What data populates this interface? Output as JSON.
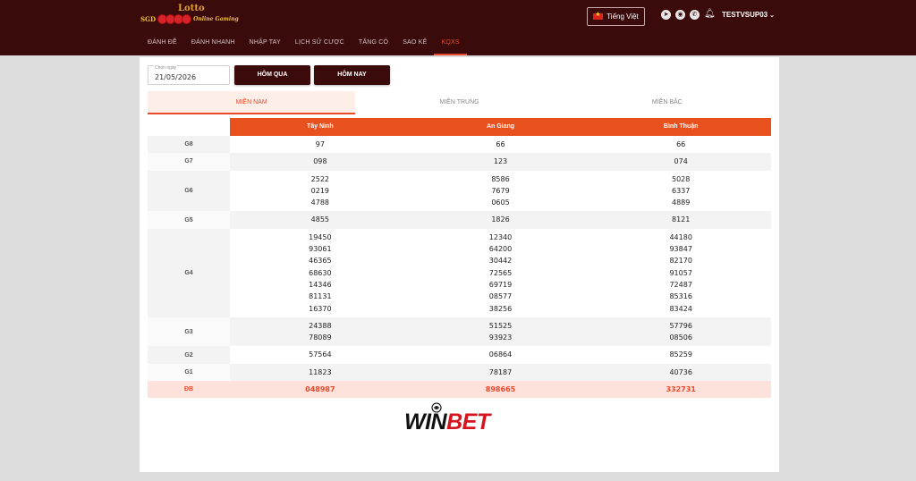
{
  "header": {
    "logo_top": "Lotto",
    "logo_pre": "SGD",
    "logo_post": "Online Gaming",
    "language": "Tiếng Việt",
    "username": "TESTVSUP03",
    "nav": [
      {
        "label": "ĐÁNH ĐỀ",
        "active": false
      },
      {
        "label": "ĐÁNH NHANH",
        "active": false
      },
      {
        "label": "NHẬP TAY",
        "active": false
      },
      {
        "label": "LỊCH SỬ CƯỢC",
        "active": false
      },
      {
        "label": "TĂNG CÓ",
        "active": false
      },
      {
        "label": "SAO KÊ",
        "active": false
      },
      {
        "label": "KQXS",
        "active": true
      }
    ],
    "icons": [
      "telegram-icon",
      "viber-icon",
      "whatsapp-icon",
      "bell-icon"
    ]
  },
  "filter": {
    "date_label": "Chọn ngày",
    "date_value": "21/05/2026",
    "yesterday": "HÔM QUA",
    "today": "HÔM NAY"
  },
  "tabs": [
    {
      "label": "MIỀN NAM",
      "active": true
    },
    {
      "label": "MIỀN TRUNG",
      "active": false
    },
    {
      "label": "MIỀN BẮC",
      "active": false
    }
  ],
  "results": {
    "provinces": [
      "Tây Ninh",
      "An Giang",
      "Bình Thuận"
    ],
    "rows": [
      {
        "prize": "G8",
        "values": [
          [
            "97"
          ],
          [
            "66"
          ],
          [
            "66"
          ]
        ]
      },
      {
        "prize": "G7",
        "values": [
          [
            "098"
          ],
          [
            "123"
          ],
          [
            "074"
          ]
        ]
      },
      {
        "prize": "G6",
        "values": [
          [
            "2522",
            "0219",
            "4788"
          ],
          [
            "8586",
            "7679",
            "0605"
          ],
          [
            "5028",
            "6337",
            "4889"
          ]
        ]
      },
      {
        "prize": "G5",
        "values": [
          [
            "4855"
          ],
          [
            "1826"
          ],
          [
            "8121"
          ]
        ]
      },
      {
        "prize": "G4",
        "values": [
          [
            "19450",
            "93061",
            "46365",
            "68630",
            "14346",
            "81131",
            "16370"
          ],
          [
            "12340",
            "64200",
            "30442",
            "72565",
            "69719",
            "08577",
            "38256"
          ],
          [
            "44180",
            "93847",
            "82170",
            "91057",
            "72487",
            "85316",
            "83424"
          ]
        ]
      },
      {
        "prize": "G3",
        "values": [
          [
            "24388",
            "78089"
          ],
          [
            "51525",
            "93923"
          ],
          [
            "57796",
            "08506"
          ]
        ]
      },
      {
        "prize": "G2",
        "values": [
          [
            "57564"
          ],
          [
            "06864"
          ],
          [
            "85259"
          ]
        ]
      },
      {
        "prize": "G1",
        "values": [
          [
            "11823"
          ],
          [
            "78187"
          ],
          [
            "40736"
          ]
        ]
      },
      {
        "prize": "ĐB",
        "values": [
          [
            "048987"
          ],
          [
            "898665"
          ],
          [
            "332731"
          ]
        ]
      }
    ]
  },
  "watermark": {
    "win": "WIN",
    "bet": "BET"
  },
  "colors": {
    "header_bg": "#3b0a0a",
    "accent": "#e8501e",
    "active_tab": "#e64a2a"
  }
}
